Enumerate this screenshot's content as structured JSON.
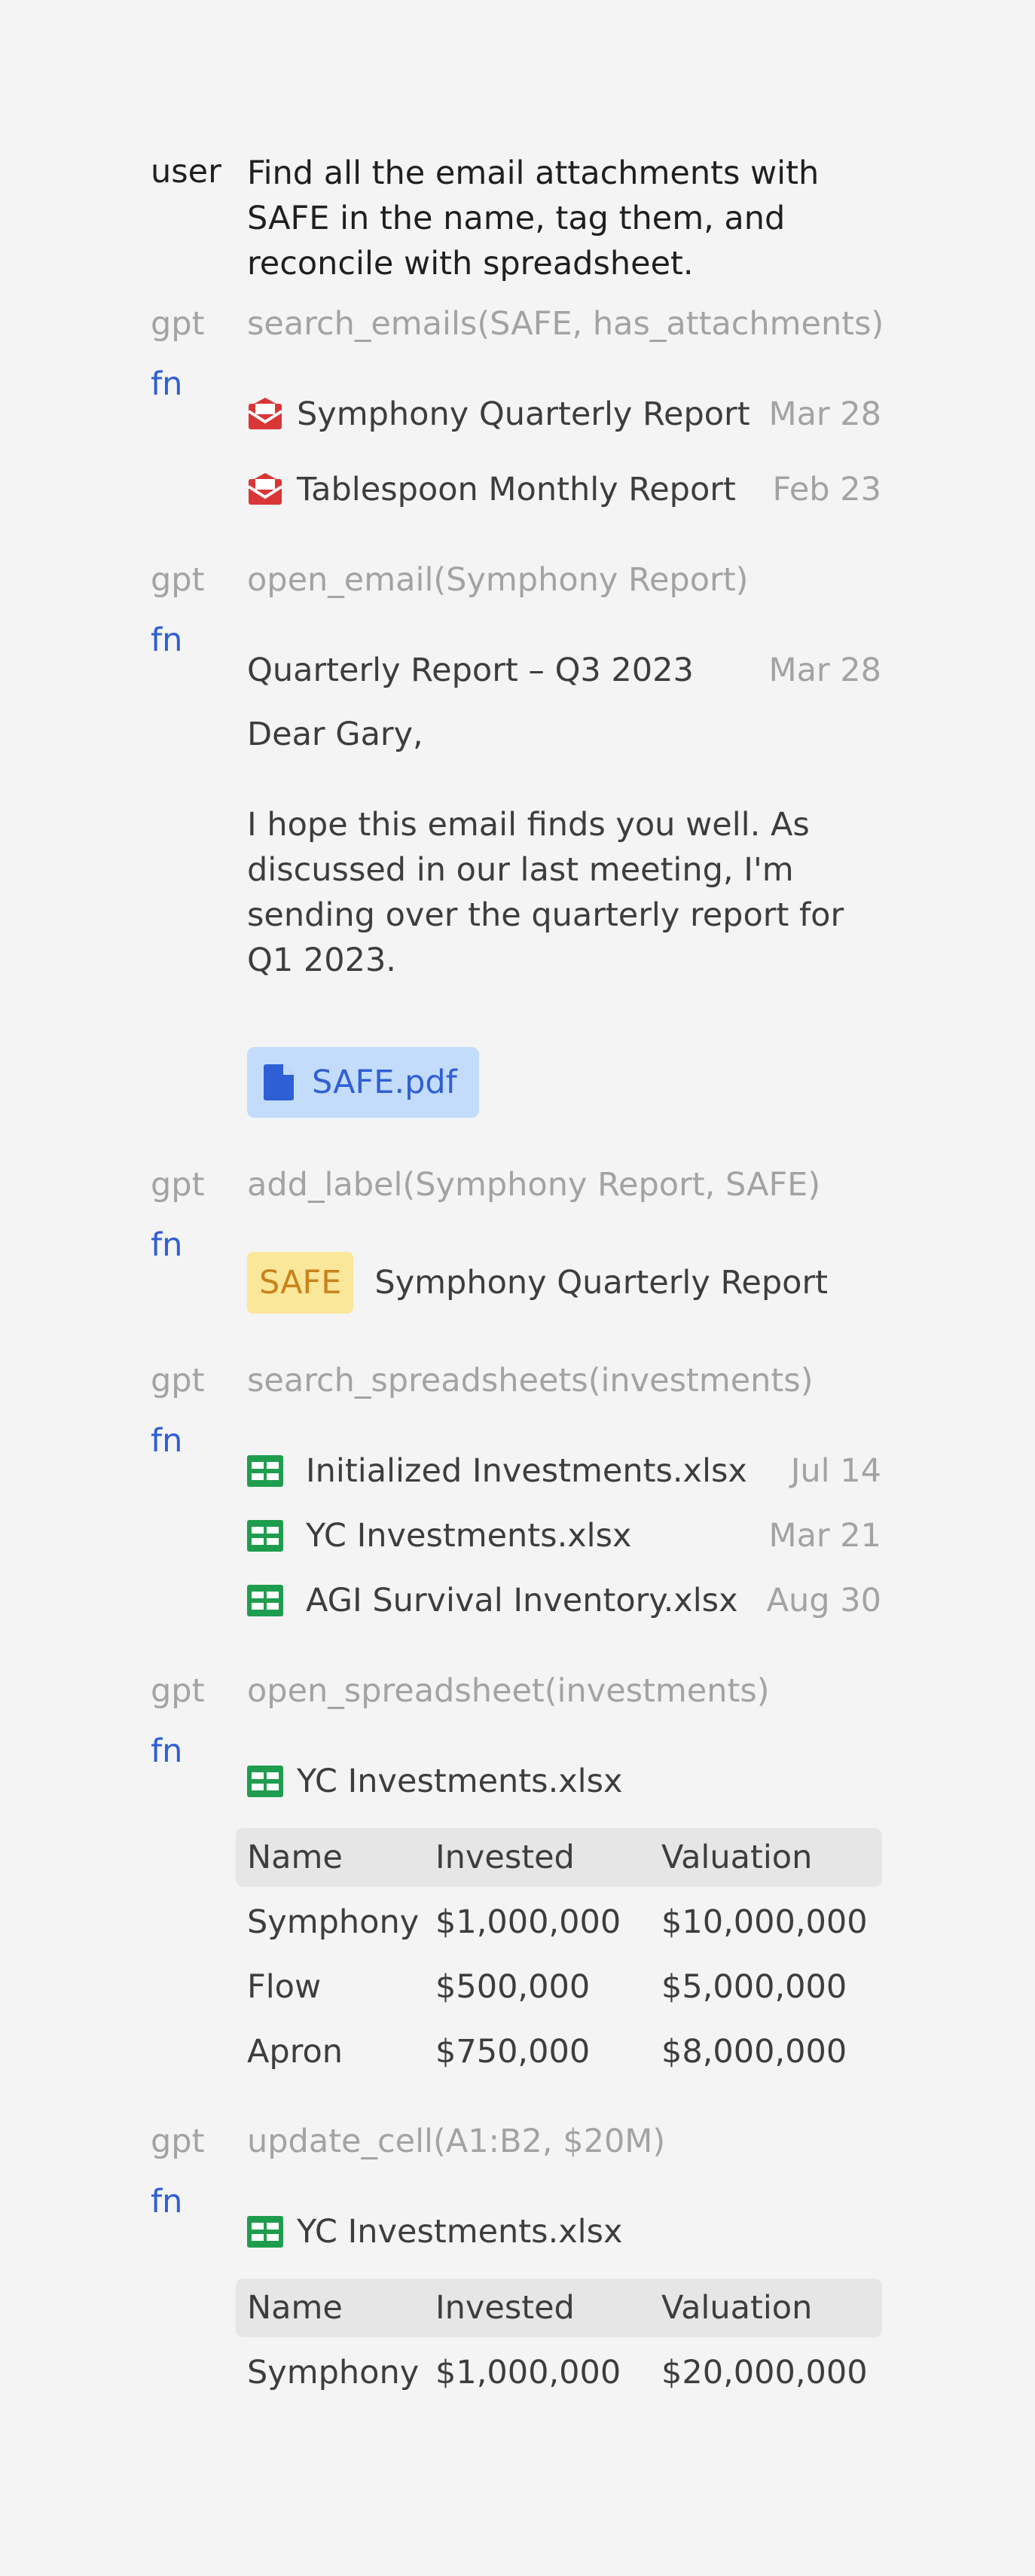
{
  "conversation": {
    "user": {
      "role": "user",
      "prompt_lines": [
        "Find all the email attachments with",
        "SAFE in the name, tag them, and",
        "reconcile with spreadsheet."
      ]
    },
    "step1": {
      "role_gpt": "gpt",
      "call": "search_emails(SAFE, has_attachments)",
      "role_fn": "fn",
      "results": [
        {
          "title": "Symphony Quarterly Report",
          "date": "Mar 28",
          "icon": "envelope-open-icon"
        },
        {
          "title": "Tablespoon Monthly Report",
          "date": "Feb 23",
          "icon": "envelope-open-icon"
        }
      ]
    },
    "step2": {
      "role_gpt": "gpt",
      "call": "open_email(Symphony Report)",
      "role_fn": "fn",
      "email": {
        "subject": "Quarterly Report – Q3 2023",
        "date": "Mar 28",
        "greeting": "Dear Gary,",
        "body_lines": [
          "I hope this email finds you well. As",
          "discussed in our last meeting, I'm",
          "sending over the quarterly report for",
          "Q1 2023."
        ],
        "attachment": "SAFE.pdf",
        "attachment_icon": "document-icon"
      }
    },
    "step3": {
      "role_gpt": "gpt",
      "call": "add_label(Symphony Report, SAFE)",
      "role_fn": "fn",
      "label": "SAFE",
      "labeled_item": "Symphony Quarterly Report"
    },
    "step4": {
      "role_gpt": "gpt",
      "call": "search_spreadsheets(investments)",
      "role_fn": "fn",
      "results": [
        {
          "title": "Initialized Investments.xlsx",
          "date": "Jul 14",
          "icon": "spreadsheet-icon"
        },
        {
          "title": "YC Investments.xlsx",
          "date": "Mar 21",
          "icon": "spreadsheet-icon"
        },
        {
          "title": "AGI Survival Inventory.xlsx",
          "date": "Aug 30",
          "icon": "spreadsheet-icon"
        }
      ]
    },
    "step5": {
      "role_gpt": "gpt",
      "call": "open_spreadsheet(investments)",
      "role_fn": "fn",
      "file": "YC Investments.xlsx",
      "headers": [
        "Name",
        "Invested",
        "Valuation"
      ],
      "rows": [
        [
          "Symphony",
          "$1,000,000",
          "$10,000,000"
        ],
        [
          "Flow",
          "$500,000",
          "$5,000,000"
        ],
        [
          "Apron",
          "$750,000",
          "$8,000,000"
        ]
      ]
    },
    "step6": {
      "role_gpt": "gpt",
      "call": "update_cell(A1:B2, $20M)",
      "role_fn": "fn",
      "file": "YC Investments.xlsx",
      "headers": [
        "Name",
        "Invested",
        "Valuation"
      ],
      "rows": [
        [
          "Symphony",
          "$1,000,000",
          "$20,000,000"
        ]
      ]
    }
  },
  "colors": {
    "background": "#f4f4f4",
    "role_fn": "#2f5fd4",
    "muted": "#a3a3a3",
    "email_icon": "#d93636",
    "sheet_icon": "#1f9d4e",
    "attachment_bg": "#c4dcfb",
    "label_bg": "#fbe79a",
    "label_text": "#c9821b"
  }
}
